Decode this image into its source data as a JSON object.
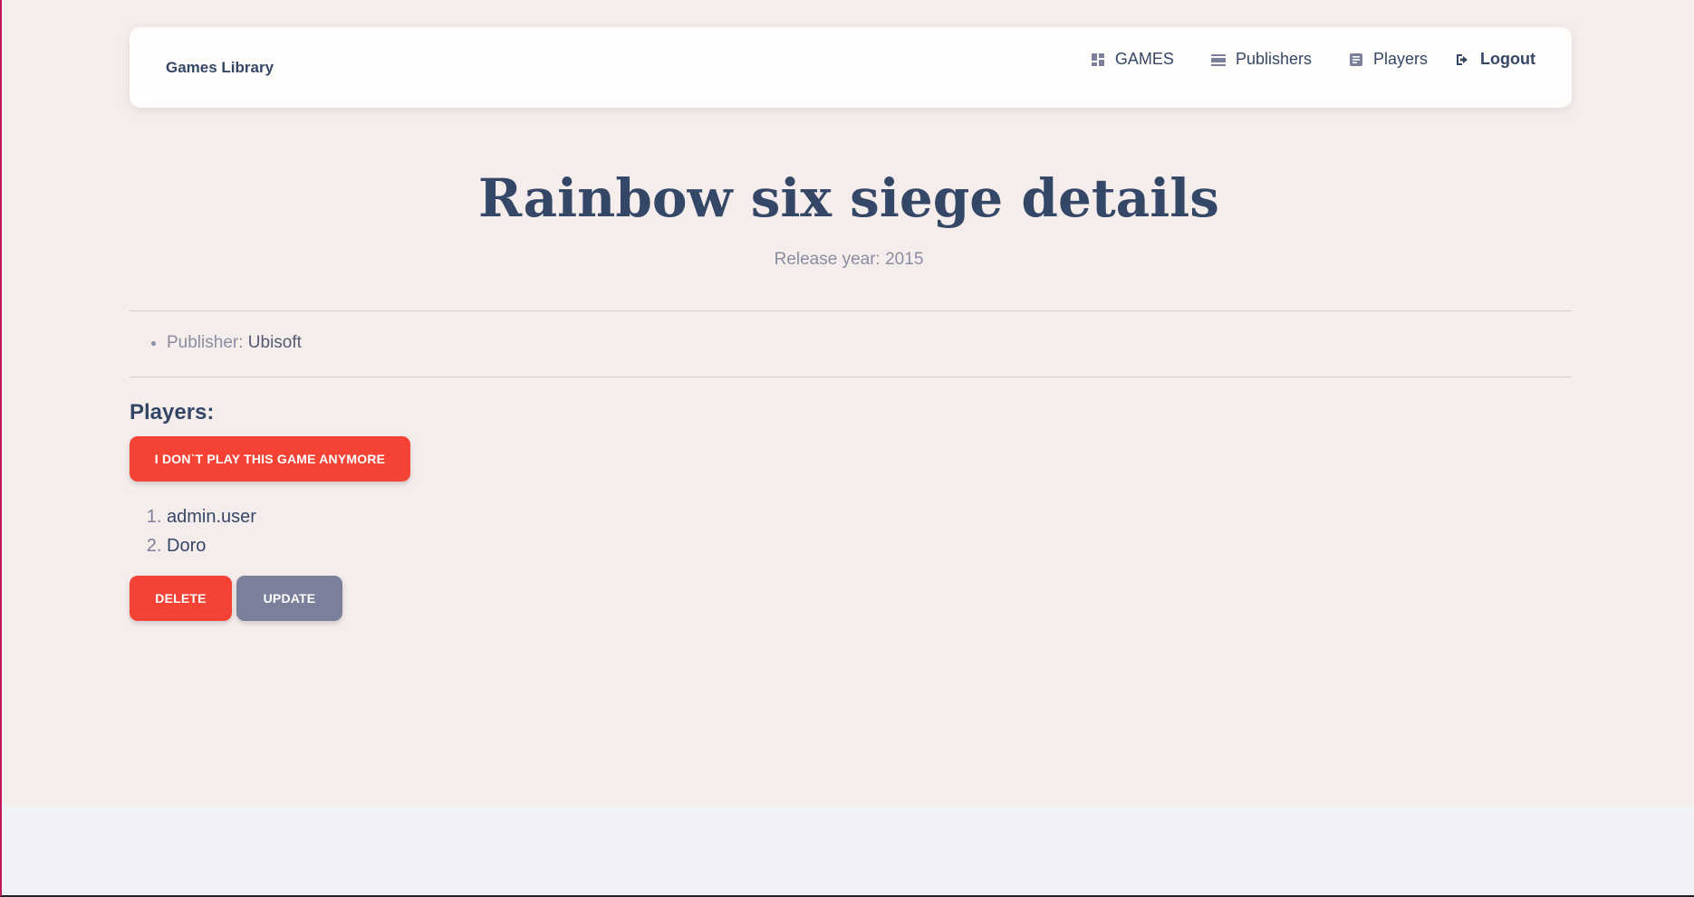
{
  "navbar": {
    "brand": "Games Library",
    "links": [
      {
        "label": "GAMES",
        "icon": "dashboard-icon"
      },
      {
        "label": "Publishers",
        "icon": "view-list-icon"
      },
      {
        "label": "Players",
        "icon": "article-icon"
      },
      {
        "label": "Logout",
        "icon": "logout-icon"
      }
    ]
  },
  "game": {
    "title": "Rainbow six siege details",
    "release_label": "Release year: 2015",
    "publisher_label": "Publisher:",
    "publisher": "Ubisoft"
  },
  "players": {
    "heading": "Players:",
    "leave_button": "I DON`T PLAY THIS GAME ANYMORE",
    "items": [
      "admin.user",
      "Doro"
    ]
  },
  "actions": {
    "delete_label": "DELETE",
    "update_label": "UPDATE"
  },
  "colors": {
    "primary_text": "#344767",
    "danger": "#f44335",
    "secondary": "#7b809a",
    "page_bg": "#f5ecec"
  }
}
